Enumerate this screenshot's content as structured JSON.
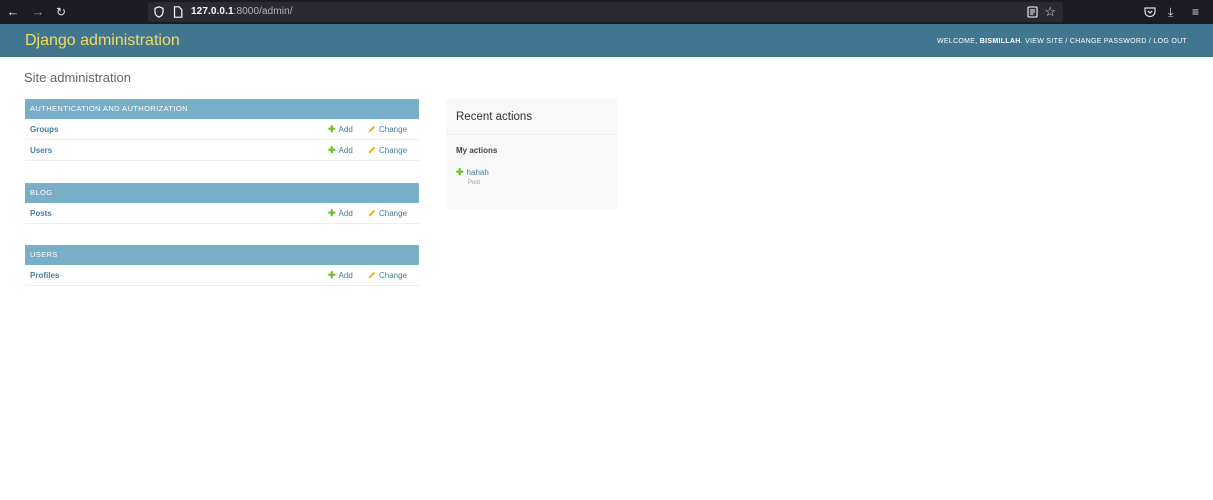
{
  "browser": {
    "url_host": "127.0.0.1",
    "url_rest": ":8000/admin/"
  },
  "header": {
    "branding": "Django administration",
    "welcome": "Welcome,",
    "username": "Bismillah",
    "view_site": "View site",
    "change_password": "Change password",
    "log_out": "Log out",
    "separator": "/"
  },
  "page_title": "Site administration",
  "modules": [
    {
      "caption": "Authentication and Authorization",
      "models": [
        {
          "name": "Groups",
          "add": "Add",
          "change": "Change"
        },
        {
          "name": "Users",
          "add": "Add",
          "change": "Change"
        }
      ]
    },
    {
      "caption": "Blog",
      "models": [
        {
          "name": "Posts",
          "add": "Add",
          "change": "Change"
        }
      ]
    },
    {
      "caption": "Users",
      "models": [
        {
          "name": "Profiles",
          "add": "Add",
          "change": "Change"
        }
      ]
    }
  ],
  "recent_actions": {
    "title": "Recent actions",
    "subtitle": "My actions",
    "items": [
      {
        "label": "hahah",
        "type": "Post"
      }
    ]
  },
  "colors": {
    "header_bg": "#417690",
    "branding": "#f5dd5d",
    "caption_bg": "#79aec8",
    "link": "#447e9b",
    "add_icon": "#70bf2b",
    "change_icon": "#efb80b"
  }
}
